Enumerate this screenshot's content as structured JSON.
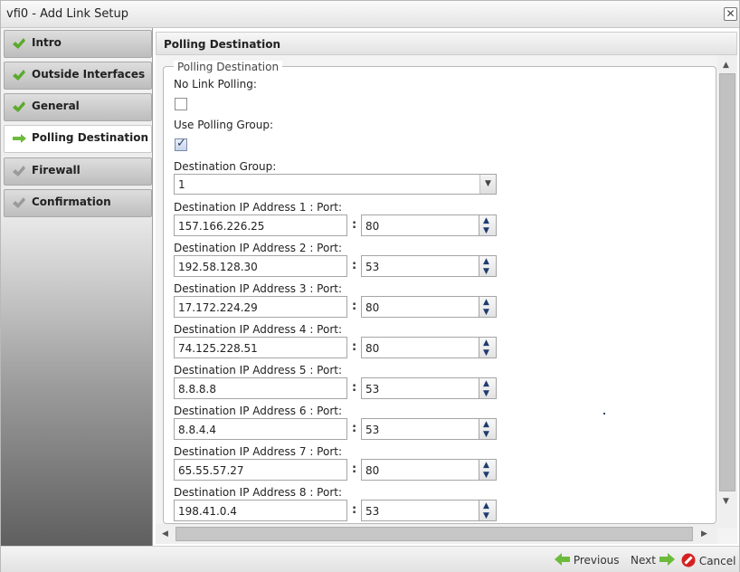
{
  "window": {
    "title": "vfi0 - Add Link Setup",
    "close_glyph": "✕"
  },
  "colors": {
    "check_green": "#5aaa2a",
    "check_gray": "#9a9a9a",
    "arrow_green": "#6cbb3c",
    "cancel_red": "#d62020"
  },
  "sidebar": {
    "items": [
      {
        "label": "Intro",
        "state": "done",
        "icon": "check-icon"
      },
      {
        "label": "Outside Interfaces",
        "state": "done",
        "icon": "check-icon"
      },
      {
        "label": "General",
        "state": "done",
        "icon": "check-icon"
      },
      {
        "label": "Polling Destination",
        "state": "active",
        "icon": "arrow-right-icon"
      },
      {
        "label": "Firewall",
        "state": "pending",
        "icon": "check-icon"
      },
      {
        "label": "Confirmation",
        "state": "pending",
        "icon": "check-icon"
      }
    ]
  },
  "panel": {
    "title": "Polling Destination",
    "fieldset_legend": "Polling Destination",
    "no_link_polling": {
      "label": "No Link Polling:",
      "checked": false
    },
    "use_polling_group": {
      "label": "Use Polling Group:",
      "checked": true
    },
    "destination_group": {
      "label": "Destination Group:",
      "value": "1"
    },
    "destinations": [
      {
        "label": "Destination IP Address 1 : Port:",
        "ip": "157.166.226.25",
        "port": "80"
      },
      {
        "label": "Destination IP Address 2 : Port:",
        "ip": "192.58.128.30",
        "port": "53"
      },
      {
        "label": "Destination IP Address 3 : Port:",
        "ip": "17.172.224.29",
        "port": "80"
      },
      {
        "label": "Destination IP Address 4 : Port:",
        "ip": "74.125.228.51",
        "port": "80"
      },
      {
        "label": "Destination IP Address 5 : Port:",
        "ip": "8.8.8.8",
        "port": "53"
      },
      {
        "label": "Destination IP Address 6 : Port:",
        "ip": "8.8.4.4",
        "port": "53"
      },
      {
        "label": "Destination IP Address 7 : Port:",
        "ip": "65.55.57.27",
        "port": "80"
      },
      {
        "label": "Destination IP Address 8 : Port:",
        "ip": "198.41.0.4",
        "port": "53"
      }
    ],
    "separator": ":"
  },
  "footer": {
    "previous": "Previous",
    "next": "Next",
    "cancel": "Cancel"
  }
}
